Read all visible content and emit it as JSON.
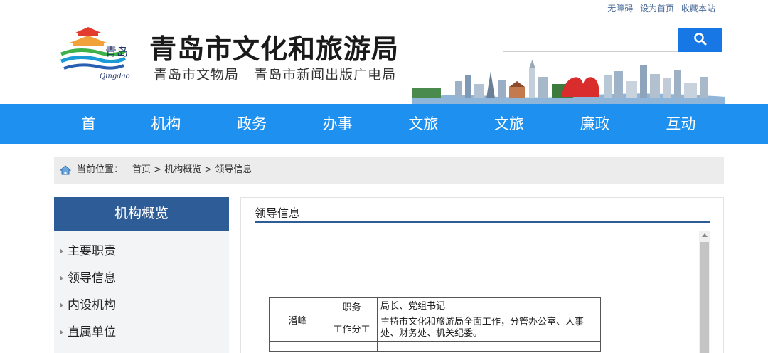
{
  "toplinks": {
    "accessibility": "无障碍",
    "set_home": "设为首页",
    "bookmark": "收藏本站"
  },
  "header": {
    "title": "青岛市文化和旅游局",
    "subtitle_1": "青岛市文物局",
    "subtitle_2": "青岛市新闻出版广电局",
    "logo_text": "青岛",
    "logo_latin": "Qingdao"
  },
  "search": {
    "value": "",
    "placeholder": ""
  },
  "nav": {
    "items": [
      "首页",
      "机构概览",
      "政务公开",
      "办事大厅",
      "文旅资源",
      "文旅黄页",
      "廉政监督",
      "互动交流"
    ]
  },
  "breadcrumb": {
    "label": "当前位置：",
    "home": "首页",
    "sep": " > ",
    "section": "机构概览",
    "current": "领导信息"
  },
  "sidebar": {
    "title": "机构概览",
    "items": [
      "主要职责",
      "领导信息",
      "内设机构",
      "直属单位"
    ]
  },
  "main": {
    "title": "领导信息",
    "leader": {
      "name": "潘峰",
      "role_label": "职务",
      "role_value": "局长、党组书记",
      "duty_label": "工作分工",
      "duty_value": "主持市文化和旅游局全面工作，分管办公室、人事处、财务处、机关纪委。"
    }
  },
  "colors": {
    "nav": "#1e90f0",
    "accent": "#2d5c97",
    "search_button": "#1677e5"
  }
}
